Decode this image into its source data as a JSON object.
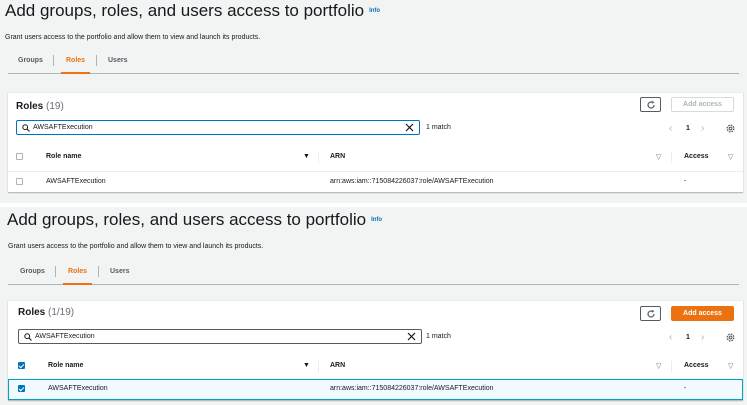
{
  "screens": [
    {
      "title": "Add groups, roles, and users access to portfolio",
      "info_link": "Info",
      "description": "Grant users access to the portfolio and allow them to view and launch its products.",
      "tabs": [
        "Groups",
        "Roles",
        "Users"
      ],
      "active_tab": "Roles",
      "panel": {
        "title": "Roles",
        "count": "(19)",
        "add_access_label": "Add access",
        "add_access_enabled": false,
        "search_value": "AWSAFTExecution",
        "match_text": "1 match",
        "page_number": "1",
        "columns": [
          "Role name",
          "ARN",
          "Access"
        ],
        "rows": [
          {
            "role_name": "AWSAFTExecution",
            "arn": "arn:aws:iam::715084226037:role/AWSAFTExecution",
            "access": "-",
            "selected": false
          }
        ]
      }
    },
    {
      "title": "Add groups, roles, and users access to portfolio",
      "info_link": "Info",
      "description": "Grant users access to the portfolio and allow them to view and launch its products.",
      "tabs": [
        "Groups",
        "Roles",
        "Users"
      ],
      "active_tab": "Roles",
      "panel": {
        "title": "Roles",
        "count": "(1/19)",
        "add_access_label": "Add access",
        "add_access_enabled": true,
        "search_value": "AWSAFTExecution",
        "match_text": "1 match",
        "page_number": "1",
        "columns": [
          "Role name",
          "ARN",
          "Access"
        ],
        "rows": [
          {
            "role_name": "AWSAFTExecution",
            "arn": "arn:aws:iam::715084226037:role/AWSAFTExecution",
            "access": "-",
            "selected": true
          }
        ]
      }
    }
  ],
  "icons": {
    "refresh": "refresh-icon",
    "search": "search-icon",
    "clear": "close-icon",
    "prev": "chevron-left-icon",
    "next": "chevron-right-icon",
    "settings": "gear-icon",
    "sort": "caret-down-icon"
  },
  "colors": {
    "accent_orange": "#ec7211",
    "link_blue": "#0073bb",
    "selected_row_bg": "#f1faff",
    "selected_row_border": "#00a1c9",
    "page_bg": "#f2f3f3"
  }
}
